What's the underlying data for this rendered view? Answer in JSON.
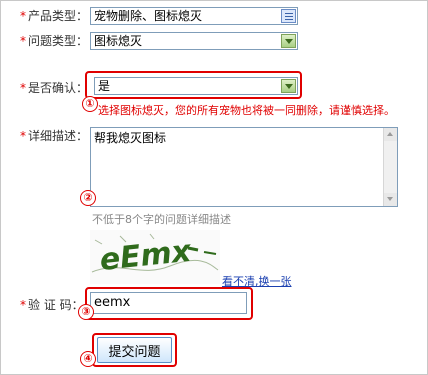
{
  "form": {
    "product_type": {
      "label": "产品类型：",
      "value": "宠物删除、图标熄灭"
    },
    "issue_type": {
      "label": "问题类型：",
      "value": "图标熄灭"
    },
    "confirm": {
      "label": "是否确认：",
      "value": "是",
      "warning": "选择图标熄灭，您的所有宠物也将被一同删除，请谨慎选择。"
    },
    "description": {
      "label": "详细描述：",
      "value": "帮我熄灭图标",
      "hint": "不低于8个字的问题详细描述"
    },
    "captcha": {
      "image_text": "eEmx",
      "refresh_link": "看不清,换一张",
      "label": "验 证 码：",
      "value": "eemx"
    },
    "submit": {
      "label": "提交问题"
    },
    "required_mark": "*"
  },
  "annotations": [
    "①",
    "②",
    "③",
    "④"
  ],
  "colors": {
    "required": "#e00000",
    "highlight_box": "#e00000",
    "hint": "#888888",
    "link": "#1a3fb0",
    "captcha_text": "#2f6b1c"
  }
}
